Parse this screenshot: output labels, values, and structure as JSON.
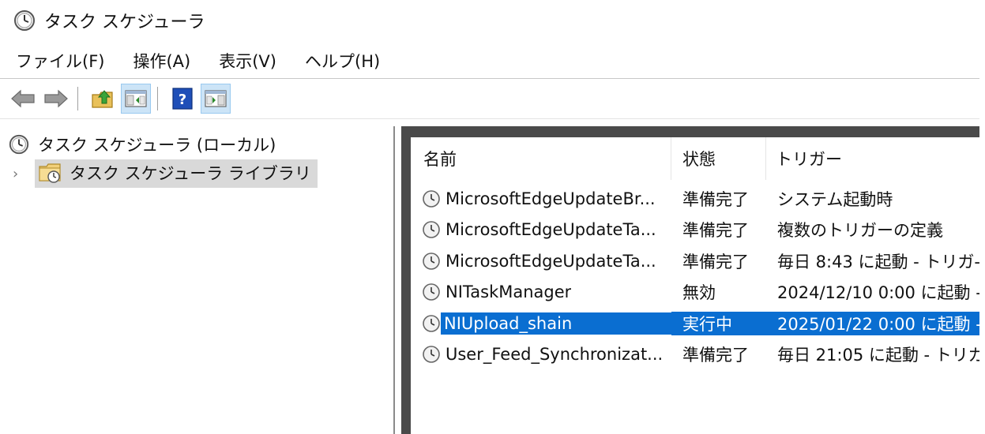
{
  "window": {
    "title": "タスク スケジューラ"
  },
  "menu": {
    "items": [
      "ファイル(F)",
      "操作(A)",
      "表示(V)",
      "ヘルプ(H)"
    ]
  },
  "toolbar": {
    "buttons": [
      {
        "icon": "back-arrow-icon"
      },
      {
        "icon": "forward-arrow-icon"
      },
      {
        "icon": "folder-up-icon"
      },
      {
        "icon": "show-hide-console-tree-icon"
      },
      {
        "icon": "help-icon"
      },
      {
        "icon": "show-hide-action-pane-icon"
      }
    ]
  },
  "tree": {
    "root_label": "タスク スケジューラ (ローカル)",
    "child_label": "タスク スケジューラ ライブラリ"
  },
  "list": {
    "columns": {
      "name": "名前",
      "status": "状態",
      "trigger": "トリガー"
    },
    "rows": [
      {
        "name": "MicrosoftEdgeUpdateBr...",
        "status": "準備完了",
        "trigger": "システム起動時"
      },
      {
        "name": "MicrosoftEdgeUpdateTa...",
        "status": "準備完了",
        "trigger": "複数のトリガーの定義"
      },
      {
        "name": "MicrosoftEdgeUpdateTa...",
        "status": "準備完了",
        "trigger": "毎日 8:43 に起動 - トリガ-"
      },
      {
        "name": "NITaskManager",
        "status": "無効",
        "trigger": "2024/12/10 0:00 に起動 -"
      },
      {
        "name": "NIUpload_shain",
        "status": "実行中",
        "trigger": "2025/01/22 0:00 に起動 -"
      },
      {
        "name": "User_Feed_Synchronizat...",
        "status": "準備完了",
        "trigger": "毎日 21:05 に起動 - トリガ"
      }
    ],
    "selected_index": 4
  },
  "colors": {
    "selection": "#0a6ed1",
    "tree_selected_bg": "#d9d9d9",
    "toolbar_active": "#cce4f7"
  }
}
